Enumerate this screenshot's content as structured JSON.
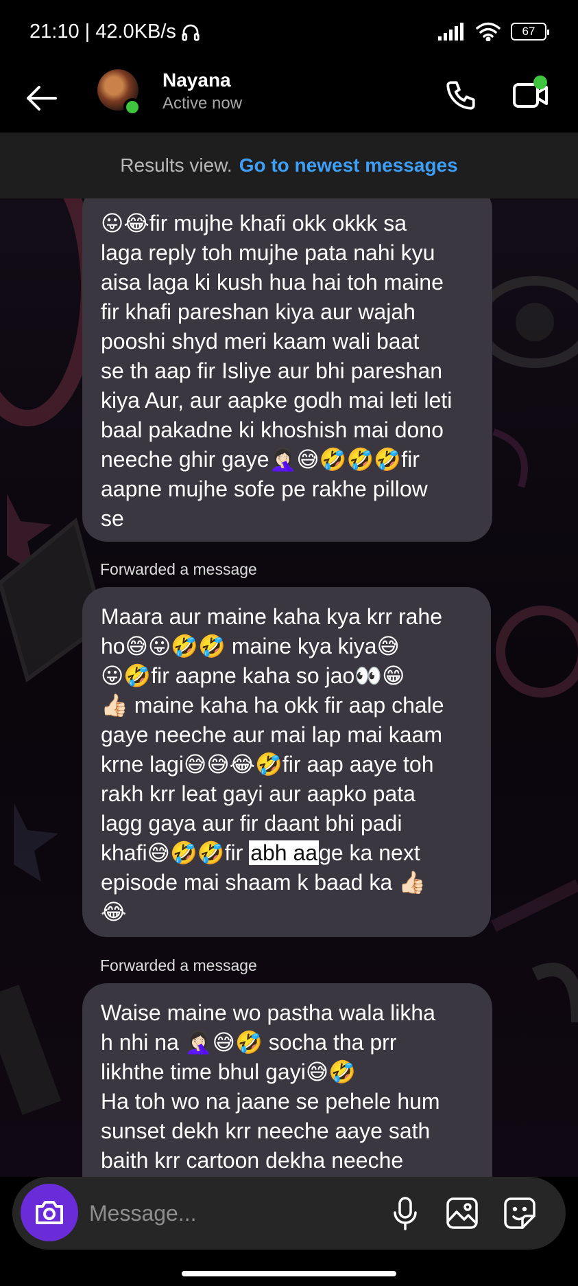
{
  "status_bar": {
    "time_speed": "21:10 | 42.0KB/s",
    "battery": "67"
  },
  "header": {
    "contact_name": "Nayana",
    "contact_status": "Active now"
  },
  "banner": {
    "text": "Results view.",
    "link": "Go to newest messages"
  },
  "messages": [
    {
      "forwarded_label": "",
      "text": "😛😂fir mujhe khafi okk okkk sa\nlaga reply toh mujhe pata nahi kyu\naisa laga ki kush hua hai toh maine\nfir khafi pareshan kiya aur wajah\npooshi shyd meri kaam wali baat\nse th aap fir Isliye aur bhi pareshan\nkiya Aur, aur aapke godh mai leti leti\nbaal pakadne ki khoshish mai dono\nneeche ghir gaye🤦🏻‍♀️😅🤣🤣🤣fir\naapne mujhe sofe pe rakhe pillow\nse"
    },
    {
      "forwarded_label": "Forwarded a message",
      "text_before": "Maara aur maine kaha kya krr rahe\nho😅😛🤣🤣 maine kya kiya😅\n😛🤣fir aapne kaha so jao👀😁\n👍🏻 maine kaha ha okk fir aap chale\ngaye neeche aur mai lap mai kaam\nkrne lagi😅😅😂🤣fir aap aaye toh\nrakh krr leat gayi aur aapko pata\nlagg gaya aur fir daant bhi padi\nkhafi😅🤣🤣fir ",
      "highlight": "abh aa",
      "text_after": "ge ka next\nepisode mai shaam k baad ka 👍🏻\n😂"
    },
    {
      "forwarded_label": "Forwarded a message",
      "text": "Waise maine wo pastha wala likha\nh nhi na 🤦🏻‍♀️😅🤣 socha tha prr\nlikhthe time bhul gayi😅🤣\nHa toh wo na jaane se pehele hum\nsunset dekh krr neeche aaye sath\nbaith krr cartoon dekha neeche"
    }
  ],
  "composer": {
    "placeholder": "Message..."
  },
  "colors": {
    "accent_blue": "#3d9ff7",
    "camera_purple": "#6a2bd9",
    "active_green": "#3ec43e",
    "bubble": "#3a3740"
  },
  "icons": [
    "headphones-icon",
    "signal-icon",
    "wifi-icon",
    "battery-icon",
    "back-arrow-icon",
    "phone-icon",
    "video-call-icon",
    "camera-icon",
    "microphone-icon",
    "gallery-icon",
    "sticker-icon"
  ]
}
